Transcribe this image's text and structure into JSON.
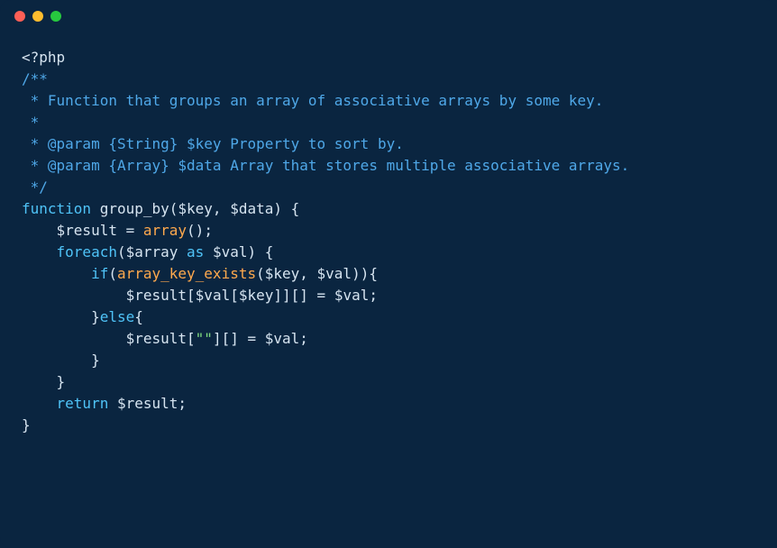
{
  "code": {
    "l1": "<?php",
    "l2": "",
    "l3": "/**",
    "l4": " * Function that groups an array of associative arrays by some key.",
    "l5": " *",
    "l6": " * @param {String} $key Property to sort by.",
    "l7": " * @param {Array} $data Array that stores multiple associative arrays.",
    "l8": " */",
    "l9_kw": "function",
    "l9_name": " group_by(",
    "l9_p1": "$key",
    "l9_c1": ", ",
    "l9_p2": "$data",
    "l9_end": ") {",
    "l10_a": "    ",
    "l10_v": "$result",
    "l10_b": " = ",
    "l10_fn": "array",
    "l10_c": "();",
    "l11": "",
    "l12_a": "    ",
    "l12_kw": "foreach",
    "l12_b": "(",
    "l12_v1": "$array",
    "l12_c": " ",
    "l12_kw2": "as",
    "l12_d": " ",
    "l12_v2": "$val",
    "l12_e": ") {",
    "l13_a": "        ",
    "l13_kw": "if",
    "l13_b": "(",
    "l13_fn": "array_key_exists",
    "l13_c": "(",
    "l13_v1": "$key",
    "l13_d": ", ",
    "l13_v2": "$val",
    "l13_e": ")){",
    "l14_a": "            ",
    "l14_v1": "$result",
    "l14_b": "[",
    "l14_v2": "$val",
    "l14_c": "[",
    "l14_v3": "$key",
    "l14_d": "]][] = ",
    "l14_v4": "$val",
    "l14_e": ";",
    "l15_a": "        }",
    "l15_kw": "else",
    "l15_b": "{",
    "l16_a": "            ",
    "l16_v1": "$result",
    "l16_b": "[",
    "l16_s": "\"\"",
    "l16_c": "][] = ",
    "l16_v2": "$val",
    "l16_d": ";",
    "l17": "        }",
    "l18": "    }",
    "l19": "",
    "l20_a": "    ",
    "l20_kw": "return",
    "l20_b": " ",
    "l20_v": "$result",
    "l20_c": ";",
    "l21": "}"
  }
}
